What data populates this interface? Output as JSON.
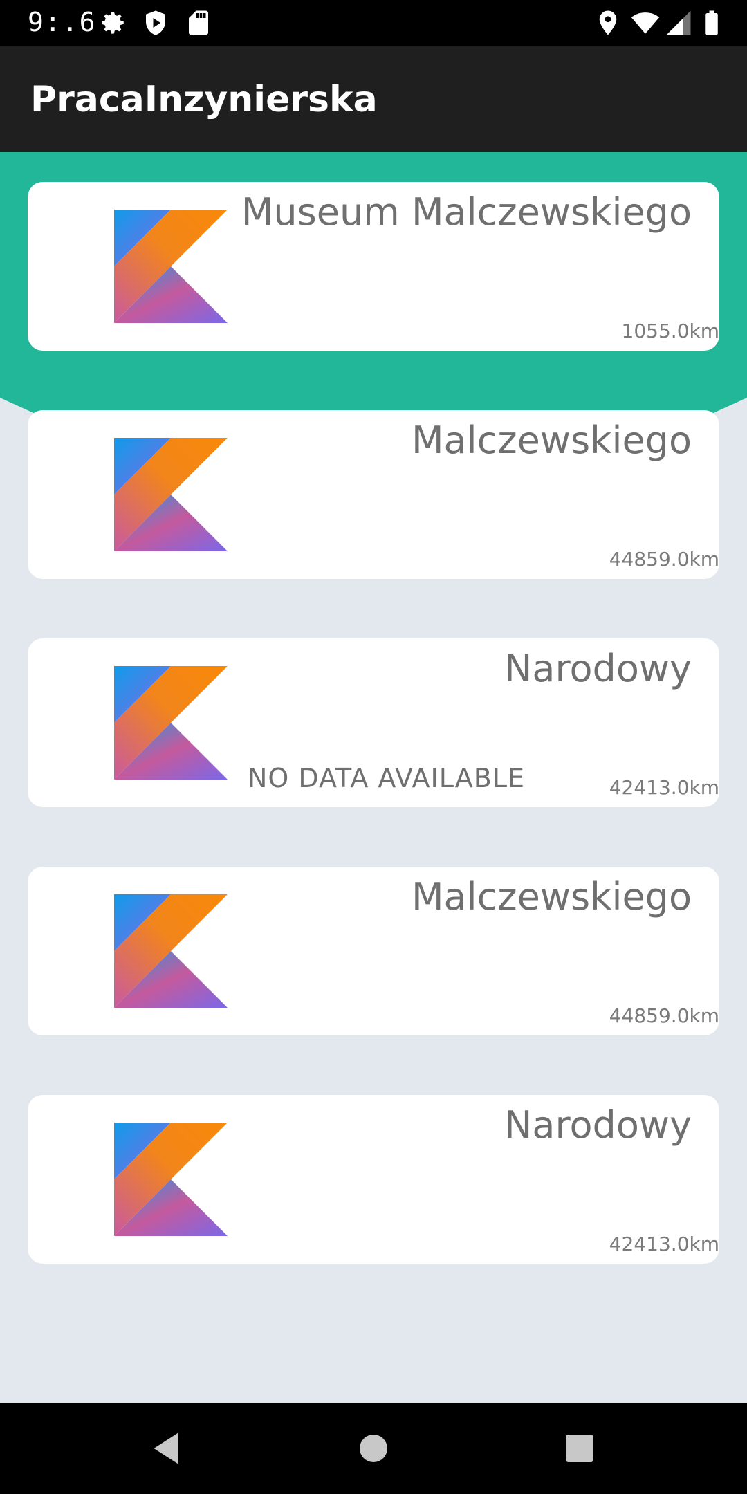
{
  "status_bar": {
    "time": "9:.6",
    "icons": [
      "gear-icon",
      "shield-icon",
      "sd-card-icon",
      "location-pin-icon",
      "wifi-icon",
      "cell-signal-icon",
      "battery-icon"
    ]
  },
  "app_bar": {
    "title": "PracaInzynierska"
  },
  "colors": {
    "app_bar": "#1f1f1f",
    "header_accent": "#21b798",
    "background": "#e3e7ee",
    "card": "#ffffff",
    "text": "#6f6f6f"
  },
  "items": [
    {
      "title": "Museum Malczewskiego",
      "distance": "1055.0km",
      "status": "",
      "logo": "kotlin-logo-icon"
    },
    {
      "title": "Malczewskiego",
      "distance": "44859.0km",
      "status": "",
      "logo": "kotlin-logo-icon"
    },
    {
      "title": "Narodowy",
      "distance": "42413.0km",
      "status": "NO DATA AVAILABLE",
      "logo": "kotlin-logo-icon"
    },
    {
      "title": "Malczewskiego",
      "distance": "44859.0km",
      "status": "",
      "logo": "kotlin-logo-icon"
    },
    {
      "title": "Narodowy",
      "distance": "42413.0km",
      "status": "",
      "logo": "kotlin-logo-icon"
    }
  ],
  "nav_bar": {
    "buttons": [
      "back-icon",
      "home-icon",
      "recents-icon"
    ]
  }
}
